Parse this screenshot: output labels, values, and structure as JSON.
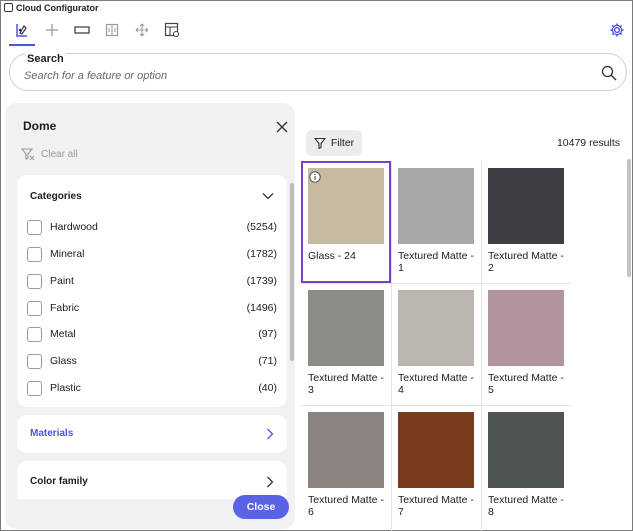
{
  "window": {
    "title": "Cloud Configurator"
  },
  "toolbar": {
    "tools": [
      "configure-icon",
      "add-icon",
      "panel-icon",
      "split-icon",
      "move-icon",
      "layout-settings-icon"
    ],
    "settings_icon": "gear-icon"
  },
  "search": {
    "label": "Search",
    "placeholder": "Search for a feature or option"
  },
  "filter_panel": {
    "title": "Dome",
    "clear_all": "Clear all",
    "categories_header": "Categories",
    "categories": [
      {
        "label": "Hardwood",
        "count": "(5254)"
      },
      {
        "label": "Mineral",
        "count": "(1782)"
      },
      {
        "label": "Paint",
        "count": "(1739)"
      },
      {
        "label": "Fabric",
        "count": "(1496)"
      },
      {
        "label": "Metal",
        "count": "(97)"
      },
      {
        "label": "Glass",
        "count": "(71)"
      },
      {
        "label": "Plastic",
        "count": "(40)"
      }
    ],
    "materials_header": "Materials",
    "color_family_header": "Color family",
    "close_label": "Close"
  },
  "results": {
    "filter_label": "Filter",
    "count_text": "10479 results",
    "items": [
      {
        "label": "Glass - 24",
        "color": "#c6baa0",
        "selected": true
      },
      {
        "label": "Textured Matte - 1",
        "color": "#a9a8a7"
      },
      {
        "label": "Textured Matte - 2",
        "color": "#3c3f43"
      },
      {
        "label": "Textured Matte - 3",
        "color": "#8a8c86"
      },
      {
        "label": "Textured Matte - 4",
        "color": "#bcb6b1"
      },
      {
        "label": "Textured Matte - 5",
        "color": "#b293a0"
      },
      {
        "label": "Textured Matte - 6",
        "color": "#8a8380"
      },
      {
        "label": "Textured Matte - 7",
        "color": "#7a3a1c"
      },
      {
        "label": "Textured Matte - 8",
        "color": "#4f5552"
      }
    ]
  },
  "colors": {
    "accent": "#5a63e8",
    "link": "#4a55e8",
    "selection": "#7b3fc4"
  }
}
